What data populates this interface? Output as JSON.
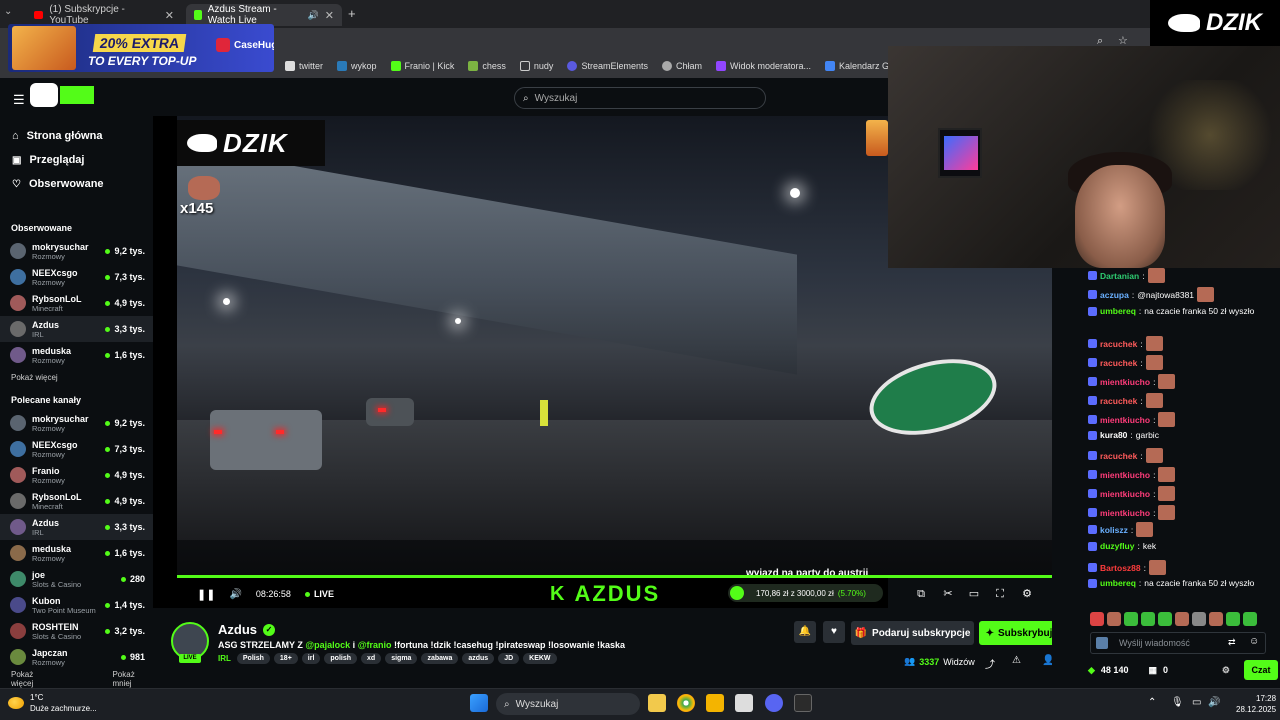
{
  "browser": {
    "tabs": [
      {
        "title": "(1) Subskrypcje - YouTube"
      },
      {
        "title": "Azdus Stream - Watch Live"
      }
    ],
    "bookmarks": [
      "twitter",
      "wykop",
      "Franio | Kick",
      "chess",
      "nudy",
      "StreamElements",
      "Chłam",
      "Widok moderatora...",
      "Kalendarz Google -..."
    ]
  },
  "ad": {
    "headline": "20% EXTRA",
    "subline": "TO EVERY TOP-UP",
    "brand": "CaseHug"
  },
  "overlay": {
    "dzik_logo": "DZIK",
    "multiplier": "x145",
    "caption": "wyjazd na party do austrii",
    "brand_bar": "AZDUS"
  },
  "header": {
    "search_placeholder": "Wyszukaj"
  },
  "sidebar": {
    "nav": [
      {
        "label": "Strona główna",
        "icon": "home-icon"
      },
      {
        "label": "Przeglądaj",
        "icon": "browse-icon"
      },
      {
        "label": "Obserwowane",
        "icon": "heart-icon"
      }
    ],
    "followed_title": "Obserwowane",
    "followed": [
      {
        "name": "mokrysuchar",
        "category": "Rozmowy",
        "viewers": "9,2 tys."
      },
      {
        "name": "NEEXcsgo",
        "category": "Rozmowy",
        "viewers": "7,3 tys."
      },
      {
        "name": "RybsonLoL",
        "category": "Minecraft",
        "viewers": "4,9 tys."
      },
      {
        "name": "Azdus",
        "category": "IRL",
        "viewers": "3,3 tys."
      },
      {
        "name": "meduska",
        "category": "Rozmowy",
        "viewers": "1,6 tys."
      }
    ],
    "show_more": "Pokaż więcej",
    "recommended_title": "Polecane kanały",
    "recommended": [
      {
        "name": "mokrysuchar",
        "category": "Rozmowy",
        "viewers": "9,2 tys."
      },
      {
        "name": "NEEXcsgo",
        "category": "Rozmowy",
        "viewers": "7,3 tys."
      },
      {
        "name": "Franio",
        "category": "Rozmowy",
        "viewers": "4,9 tys."
      },
      {
        "name": "RybsonLoL",
        "category": "Minecraft",
        "viewers": "4,9 tys."
      },
      {
        "name": "Azdus",
        "category": "IRL",
        "viewers": "3,3 tys."
      },
      {
        "name": "meduska",
        "category": "Rozmowy",
        "viewers": "1,6 tys."
      },
      {
        "name": "joe",
        "category": "Slots & Casino",
        "viewers": "280"
      },
      {
        "name": "Kubon",
        "category": "Two Point Museum",
        "viewers": "1,4 tys."
      },
      {
        "name": "ROSHTEIN",
        "category": "Slots & Casino",
        "viewers": "3,2 tys."
      },
      {
        "name": "Japczan",
        "category": "Rozmowy",
        "viewers": "981"
      }
    ],
    "show_more2": "Pokaż więcej",
    "show_less": "Pokaż mniej"
  },
  "player": {
    "time": "08:26:58",
    "live": "LIVE",
    "donation": {
      "text": "170,86 zł z 3000,00 zł",
      "percent": "(5.70%)",
      "progress": 0.057
    }
  },
  "stream": {
    "name": "Azdus",
    "live_badge": "LIVE",
    "title_pre": "ASG STRZELAMY Z",
    "mention1": "@pajalock",
    "mid": "i",
    "mention2": "@franio",
    "title_post": "!fortuna !dzik !casehug !pirateswap !losowanie !kaska",
    "category": "IRL",
    "tags": [
      "Polish",
      "18+",
      "irl",
      "polish",
      "xd",
      "sigma",
      "zabawa",
      "azdus",
      "JD",
      "KEKW"
    ],
    "gift_label": "Podaruj subskrypcje",
    "subscribe_label": "Subskrybuj",
    "viewers": "3337",
    "viewers_label": "Widzów"
  },
  "chat": {
    "messages": [
      {
        "user": "Dartanian",
        "text": "",
        "color": "#2ecc71",
        "emote": true
      },
      {
        "user": "aczupa",
        "text": "@najtowa8381",
        "color": "#6ab0ff",
        "emote": true
      },
      {
        "user": "umbereq",
        "text": "na czacie franka 50 zł wyszło",
        "color": "#53fc18",
        "emote": false
      },
      {
        "user": "racuchek",
        "text": "",
        "color": "#ff5b5b",
        "emote": true
      },
      {
        "user": "racuchek",
        "text": "",
        "color": "#ff5b5b",
        "emote": true
      },
      {
        "user": "mientkiucho",
        "text": "",
        "color": "#ff3c7a",
        "emote": true
      },
      {
        "user": "racuchek",
        "text": "",
        "color": "#ff5b5b",
        "emote": true
      },
      {
        "user": "mientkiucho",
        "text": "",
        "color": "#ff3c7a",
        "emote": true
      },
      {
        "user": "kura80",
        "text": "garbic",
        "color": "#ffffff",
        "emote": false
      },
      {
        "user": "racuchek",
        "text": "",
        "color": "#ff5b5b",
        "emote": true
      },
      {
        "user": "mientkiucho",
        "text": "",
        "color": "#ff3c7a",
        "emote": true
      },
      {
        "user": "mientkiucho",
        "text": "",
        "color": "#ff3c7a",
        "emote": true
      },
      {
        "user": "mientkiucho",
        "text": "",
        "color": "#ff3c7a",
        "emote": true
      },
      {
        "user": "koliszz",
        "text": "",
        "color": "#6ab0ff",
        "emote": true
      },
      {
        "user": "duzyfluy",
        "text": "kek",
        "color": "#53fc18",
        "emote": false
      },
      {
        "user": "Bartosz88",
        "text": "",
        "color": "#ff3c3c",
        "emote": true
      },
      {
        "user": "umbereq",
        "text": "na czacie franka 50 zł wyszło",
        "color": "#53fc18",
        "emote": false
      }
    ],
    "input_placeholder": "Wyślij wiadomość",
    "points": "48 140",
    "kicks": "0",
    "send_label": "Czat"
  },
  "webcam_logo": "DZIK",
  "taskbar": {
    "weather_temp": "1°C",
    "weather_desc": "Duże zachmurze...",
    "search": "Wyszukaj",
    "time": "17:28",
    "date": "28.12.2025"
  },
  "colors": {
    "accent": "#53fc18",
    "bg": "#0b0e11"
  }
}
